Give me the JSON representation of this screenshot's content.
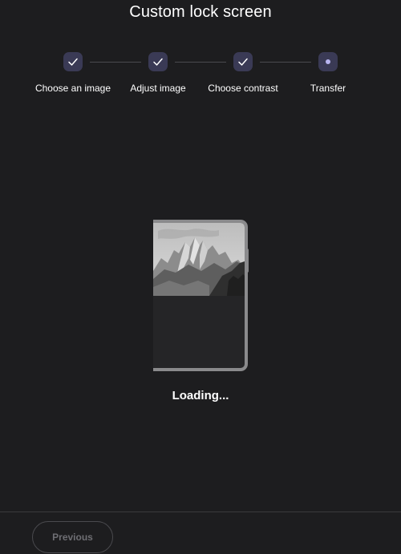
{
  "header": {
    "title": "Custom lock screen"
  },
  "stepper": {
    "steps": [
      {
        "label": "Choose an image",
        "state": "complete",
        "icon": "check-icon"
      },
      {
        "label": "Adjust image",
        "state": "complete",
        "icon": "check-icon"
      },
      {
        "label": "Choose contrast",
        "state": "complete",
        "icon": "check-icon"
      },
      {
        "label": "Transfer",
        "state": "current",
        "icon": "dot-icon"
      }
    ]
  },
  "preview": {
    "image": "mountain-landscape-grayscale"
  },
  "status": {
    "text": "Loading..."
  },
  "footer": {
    "previous_label": "Previous"
  },
  "colors": {
    "background": "#1d1d1f",
    "step_circle": "#3a3a55",
    "step_accent": "#b8b4f0",
    "disabled_text": "#6e6e73"
  }
}
